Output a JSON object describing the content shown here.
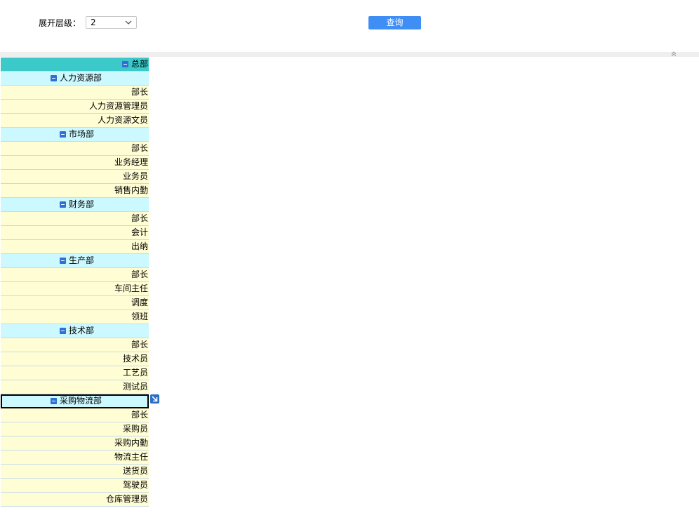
{
  "toolbar": {
    "level_label": "展开层级：",
    "level_value": "2",
    "query_label": "查询"
  },
  "tree": {
    "root": "总部",
    "departments": [
      {
        "name": "人力资源部",
        "roles": [
          "部长",
          "人力资源管理员",
          "人力资源文员"
        ]
      },
      {
        "name": "市场部",
        "roles": [
          "部长",
          "业务经理",
          "业务员",
          "销售内勤"
        ]
      },
      {
        "name": "财务部",
        "roles": [
          "部长",
          "会计",
          "出纳"
        ]
      },
      {
        "name": "生产部",
        "roles": [
          "部长",
          "车间主任",
          "调度",
          "领班"
        ]
      },
      {
        "name": "技术部",
        "roles": [
          "部长",
          "技术员",
          "工艺员",
          "测试员"
        ]
      },
      {
        "name": "采购物流部",
        "roles": [
          "部长",
          "采购员",
          "采购内勤",
          "物流主任",
          "送货员",
          "驾驶员",
          "仓库管理员"
        ]
      }
    ]
  },
  "colors": {
    "root_row": "#3cc9c9",
    "dept_row": "#ccf9ff",
    "leaf_row": "#fffdd3",
    "button": "#3f8ef5"
  }
}
